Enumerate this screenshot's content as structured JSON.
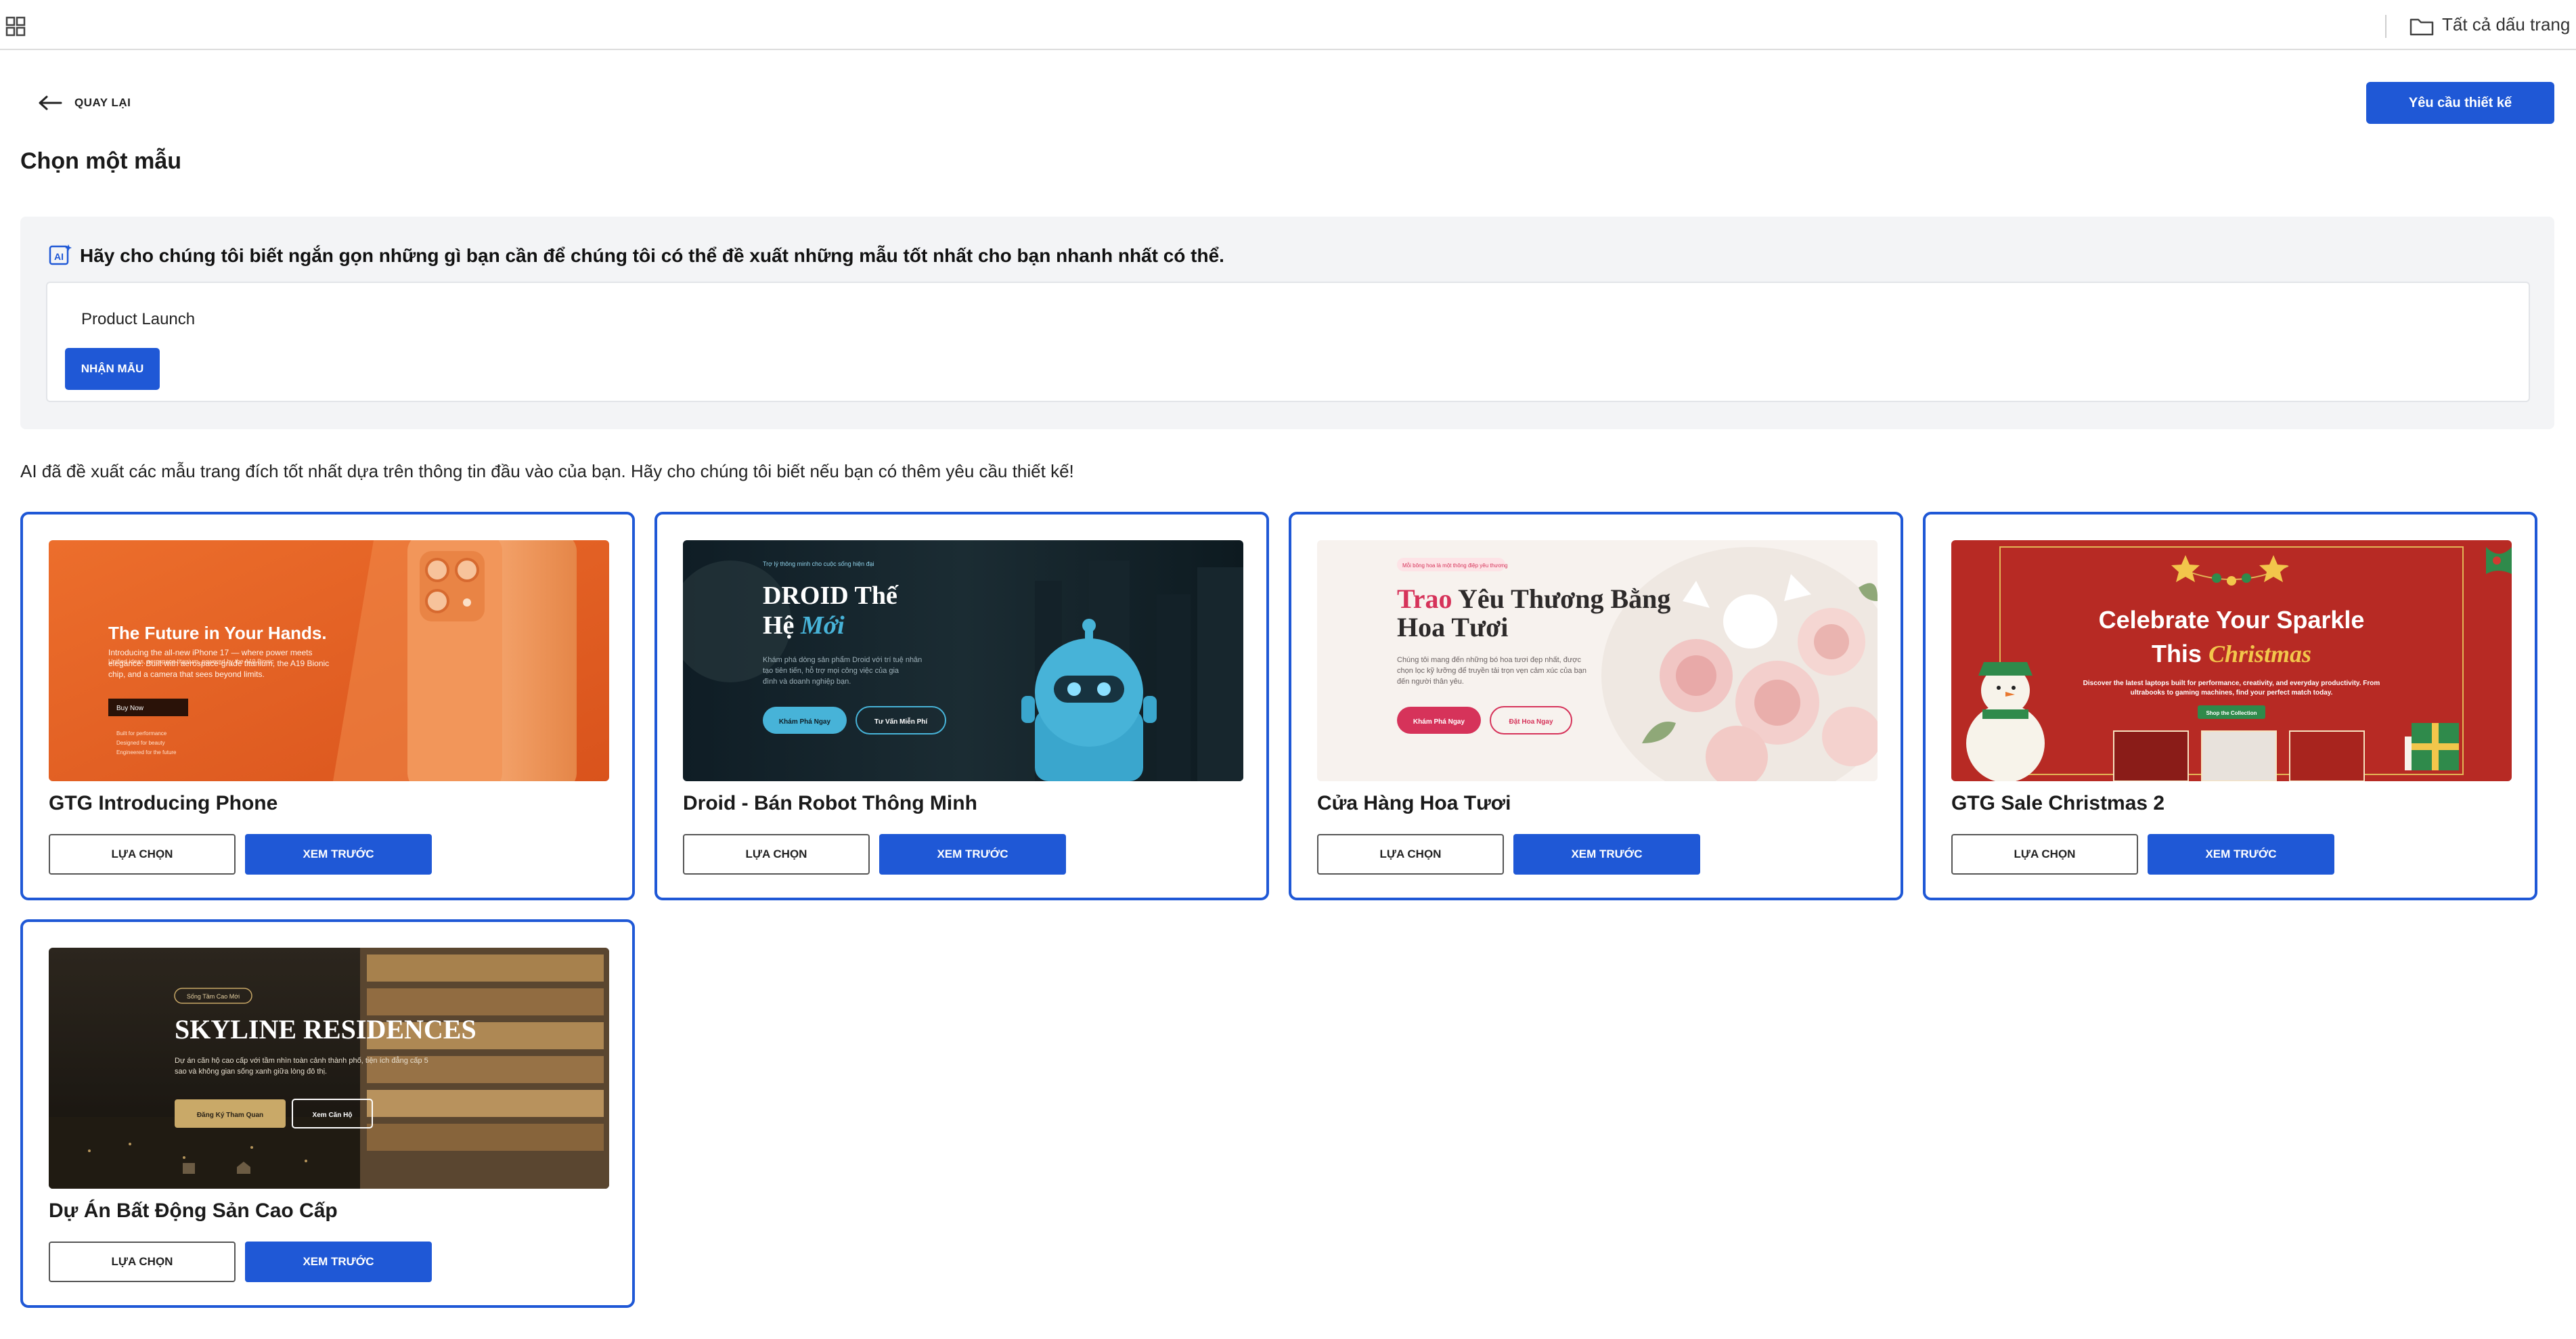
{
  "topbar": {
    "bookmarks_label": "Tất cả dấu trang"
  },
  "header": {
    "back_label": "QUAY LẠI",
    "design_request_label": "Yêu cầu thiết kế",
    "page_title": "Chọn một mẫu"
  },
  "ai_panel": {
    "prompt": "Hãy cho chúng tôi biết ngắn gọn những gì bạn cần để chúng tôi có thể đề xuất những mẫu tốt nhất cho bạn nhanh nhất có thể.",
    "input_value": "Product Launch",
    "get_button_label": "NHẬN MẪU"
  },
  "ai_note": "AI đã đề xuất các mẫu trang đích tốt nhất dựa trên thông tin đầu vào của bạn. Hãy cho chúng tôi biết nếu bạn có thêm yêu cầu thiết kế!",
  "button_labels": {
    "select": "LỰA CHỌN",
    "preview": "XEM TRƯỚC"
  },
  "templates": [
    {
      "title": "GTG Introducing Phone",
      "thumb": {
        "headline": "The Future in Your Hands.",
        "small": "Unified ideas, aerospace titanium, powered by the A19 Bionic",
        "body1": "Introducing the all-new iPhone 17 — where power meets",
        "body2": "elegance. Built with aerospace-grade titanium, the A19 Bionic",
        "body3": "chip, and a camera that sees beyond limits.",
        "cta": "Buy Now",
        "features": [
          "Built for performance",
          "Designed for beauty",
          "Engineered for the future"
        ]
      }
    },
    {
      "title": "Droid - Bán Robot Thông Minh",
      "thumb": {
        "eyebrow": "Trợ lý thông minh cho cuộc sống hiện đại",
        "line1": "DROID Thế",
        "line2a": "Hệ ",
        "line2b": "Mới",
        "body1": "Khám phá dòng sản phẩm Droid với trí tuệ nhân",
        "body2": "tạo tiên tiến, hỗ trợ mọi công việc của gia",
        "body3": "đình và doanh nghiệp bạn.",
        "btn1": "Khám Phá Ngay",
        "btn2": "Tư Vấn Miễn Phí"
      }
    },
    {
      "title": "Cửa Hàng Hoa Tươi",
      "thumb": {
        "badge": "Mỗi bông hoa là một thông điệp yêu thương",
        "line1a": "Trao ",
        "line1b": "Yêu Thương Bằng",
        "line2": "Hoa Tươi",
        "body1": "Chúng tôi mang đến những bó hoa tươi đẹp nhất, được",
        "body2": "chọn lọc kỹ lưỡng để truyền tải trọn vẹn cảm xúc của bạn",
        "body3": "đến người thân yêu.",
        "btn1": "Khám Phá Ngay",
        "btn2": "Đặt Hoa Ngay"
      }
    },
    {
      "title": "GTG Sale Christmas 2",
      "thumb": {
        "line1": "Celebrate Your Sparkle",
        "line2a": "This ",
        "line2b": "Christmas",
        "body1": "Discover the latest laptops built for performance, creativity, and everyday productivity. From",
        "body2": "ultrabooks to gaming machines, find your perfect match today.",
        "cta": "Shop the Collection"
      }
    },
    {
      "title": "Dự Án Bất Động Sản Cao Cấp",
      "thumb": {
        "eyebrow": "Sống Tầm Cao Mới",
        "headline": "SKYLINE RESIDENCES",
        "body1": "Dự án căn hộ cao cấp với tầm nhìn toàn cảnh thành phố, tiện ích đẳng cấp 5",
        "body2": "sao và không gian sống xanh giữa lòng đô thị.",
        "btn1": "Đăng Ký Tham Quan",
        "btn2": "Xem Căn Hộ"
      }
    }
  ],
  "colors": {
    "accent": "#1f58d6",
    "card_border": "#1f58d6",
    "panel_bg": "#f3f4f6"
  }
}
